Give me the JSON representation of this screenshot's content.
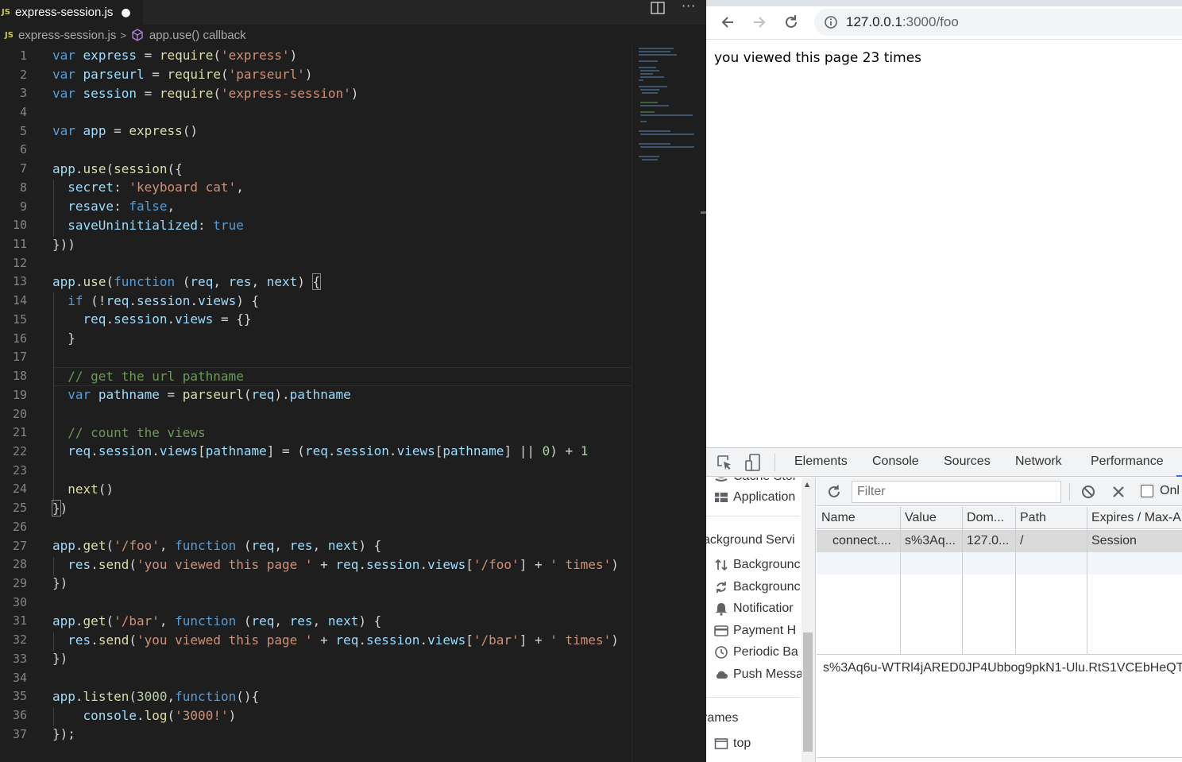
{
  "editor": {
    "tab": {
      "icon": "JS",
      "label": "express-session.js",
      "modified_dot": "●"
    },
    "more_actions": "···",
    "breadcrumb": {
      "icon": "JS",
      "file": "express-session.js",
      "separator": ">",
      "symbol": "app.use() callback"
    },
    "lines": [
      "1",
      "2",
      "3",
      "4",
      "5",
      "6",
      "7",
      "8",
      "9",
      "10",
      "11",
      "12",
      "13",
      "14",
      "15",
      "16",
      "17",
      "18",
      "19",
      "20",
      "21",
      "22",
      "23",
      "24",
      "25",
      "26",
      "27",
      "28",
      "29",
      "30",
      "31",
      "32",
      "33",
      "34",
      "35",
      "36",
      "37"
    ]
  },
  "browser": {
    "url_host": "127.0.0.1",
    "url_path": ":3000/foo",
    "page_text": "you viewed this page 23 times"
  },
  "devtools": {
    "tabs": [
      "Elements",
      "Console",
      "Sources",
      "Network",
      "Performance"
    ],
    "sidebar": {
      "cache_storage": "Cache Stor",
      "application": "Application",
      "bg_services_header": "ackground Servi",
      "items": [
        "Backgrounc",
        "Backgrounc",
        "Notificatior",
        "Payment H",
        "Periodic Ba",
        "Push Messa"
      ],
      "frames_header": "rames",
      "top": "top"
    },
    "filter_placeholder": "Filter",
    "only_label": "Onl",
    "columns": [
      "Name",
      "Value",
      "Dom...",
      "Path",
      "Expires / Max-A"
    ],
    "row": {
      "name": "connect....",
      "value": "s%3Aq...",
      "domain": "127.0...",
      "path": "/",
      "expires": "Session"
    },
    "cookie_value": "s%3Aq6u-WTRl4jARED0JP4Ubbog9pkN1-Ulu.RtS1VCEbHeQTC"
  },
  "colors": {
    "keyword": "#569cd6",
    "variable": "#9cdcfe",
    "function": "#dcdcaa",
    "string": "#ce9178",
    "number": "#b5cea8",
    "comment": "#6a9955"
  }
}
